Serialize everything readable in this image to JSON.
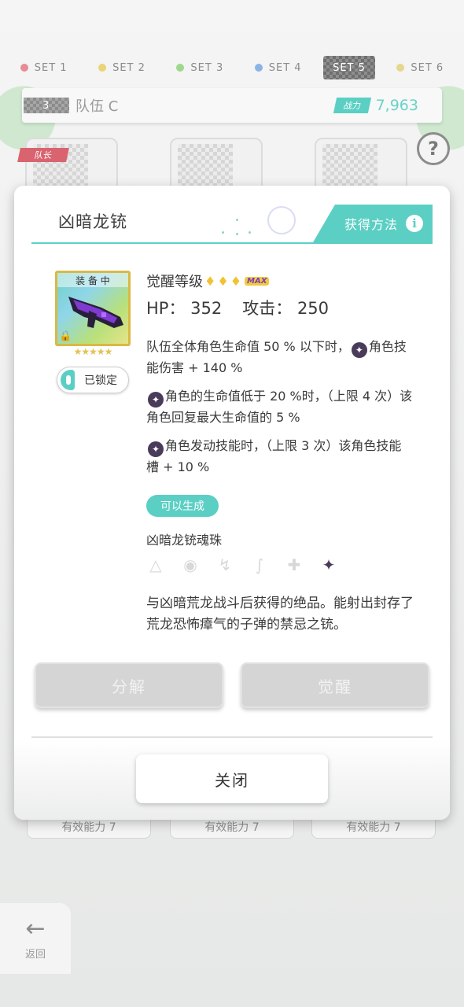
{
  "set_tabs": [
    {
      "label": "SET 1",
      "color": "#e26a76"
    },
    {
      "label": "SET 2",
      "color": "#e8c84e"
    },
    {
      "label": "SET 3",
      "color": "#82cf6a"
    },
    {
      "label": "SET 4",
      "color": "#6a9ee2"
    },
    {
      "label": "SET 5",
      "color": "#8e8e8e",
      "active": true
    },
    {
      "label": "SET 6",
      "color": "#e0cd6a"
    }
  ],
  "team": {
    "number": "3",
    "name": "队伍 C",
    "power_label": "战力",
    "power_value": "7,963"
  },
  "leader_tag": "队长",
  "help_icon": "?",
  "ability_tags": [
    "有效能力 7",
    "有效能力 7",
    "有效能力 7"
  ],
  "back": {
    "label": "返回"
  },
  "modal": {
    "title": "凶暗龙铳",
    "source_button": "获得方法",
    "equipped_label": "装 备 中",
    "stars": "★★★★★",
    "lock_label": "已锁定",
    "awaken_label": "觉醒等级",
    "max_badge": "MAX",
    "hp_label": "HP：",
    "hp_value": "352",
    "atk_label": "攻击：",
    "atk_value": "250",
    "effects": [
      {
        "before": "队伍全体角色生命值 50 % 以下时，",
        "after": "角色技能伤害 + 140 %"
      },
      {
        "before": "",
        "after": "角色的生命值低于 20 %时，（上限 4 次）该角色回复最大生命值的 5 %"
      },
      {
        "before": "",
        "after": "角色发动技能时，（上限 3 次）该角色技能槽 + 10 %"
      }
    ],
    "craftable_label": "可以生成",
    "soul_name": "凶暗龙铳魂珠",
    "flavor": "与凶暗荒龙战斗后获得的绝品。能射出封存了荒龙恐怖瘴气的子弹的禁忌之铳。",
    "dismantle_button": "分解",
    "awaken_button": "觉醒",
    "close_button": "关闭"
  },
  "colors": {
    "accent": "#5ccfc4",
    "dark_element": "#4a3b5a",
    "gold_frame": "#d9b944"
  }
}
